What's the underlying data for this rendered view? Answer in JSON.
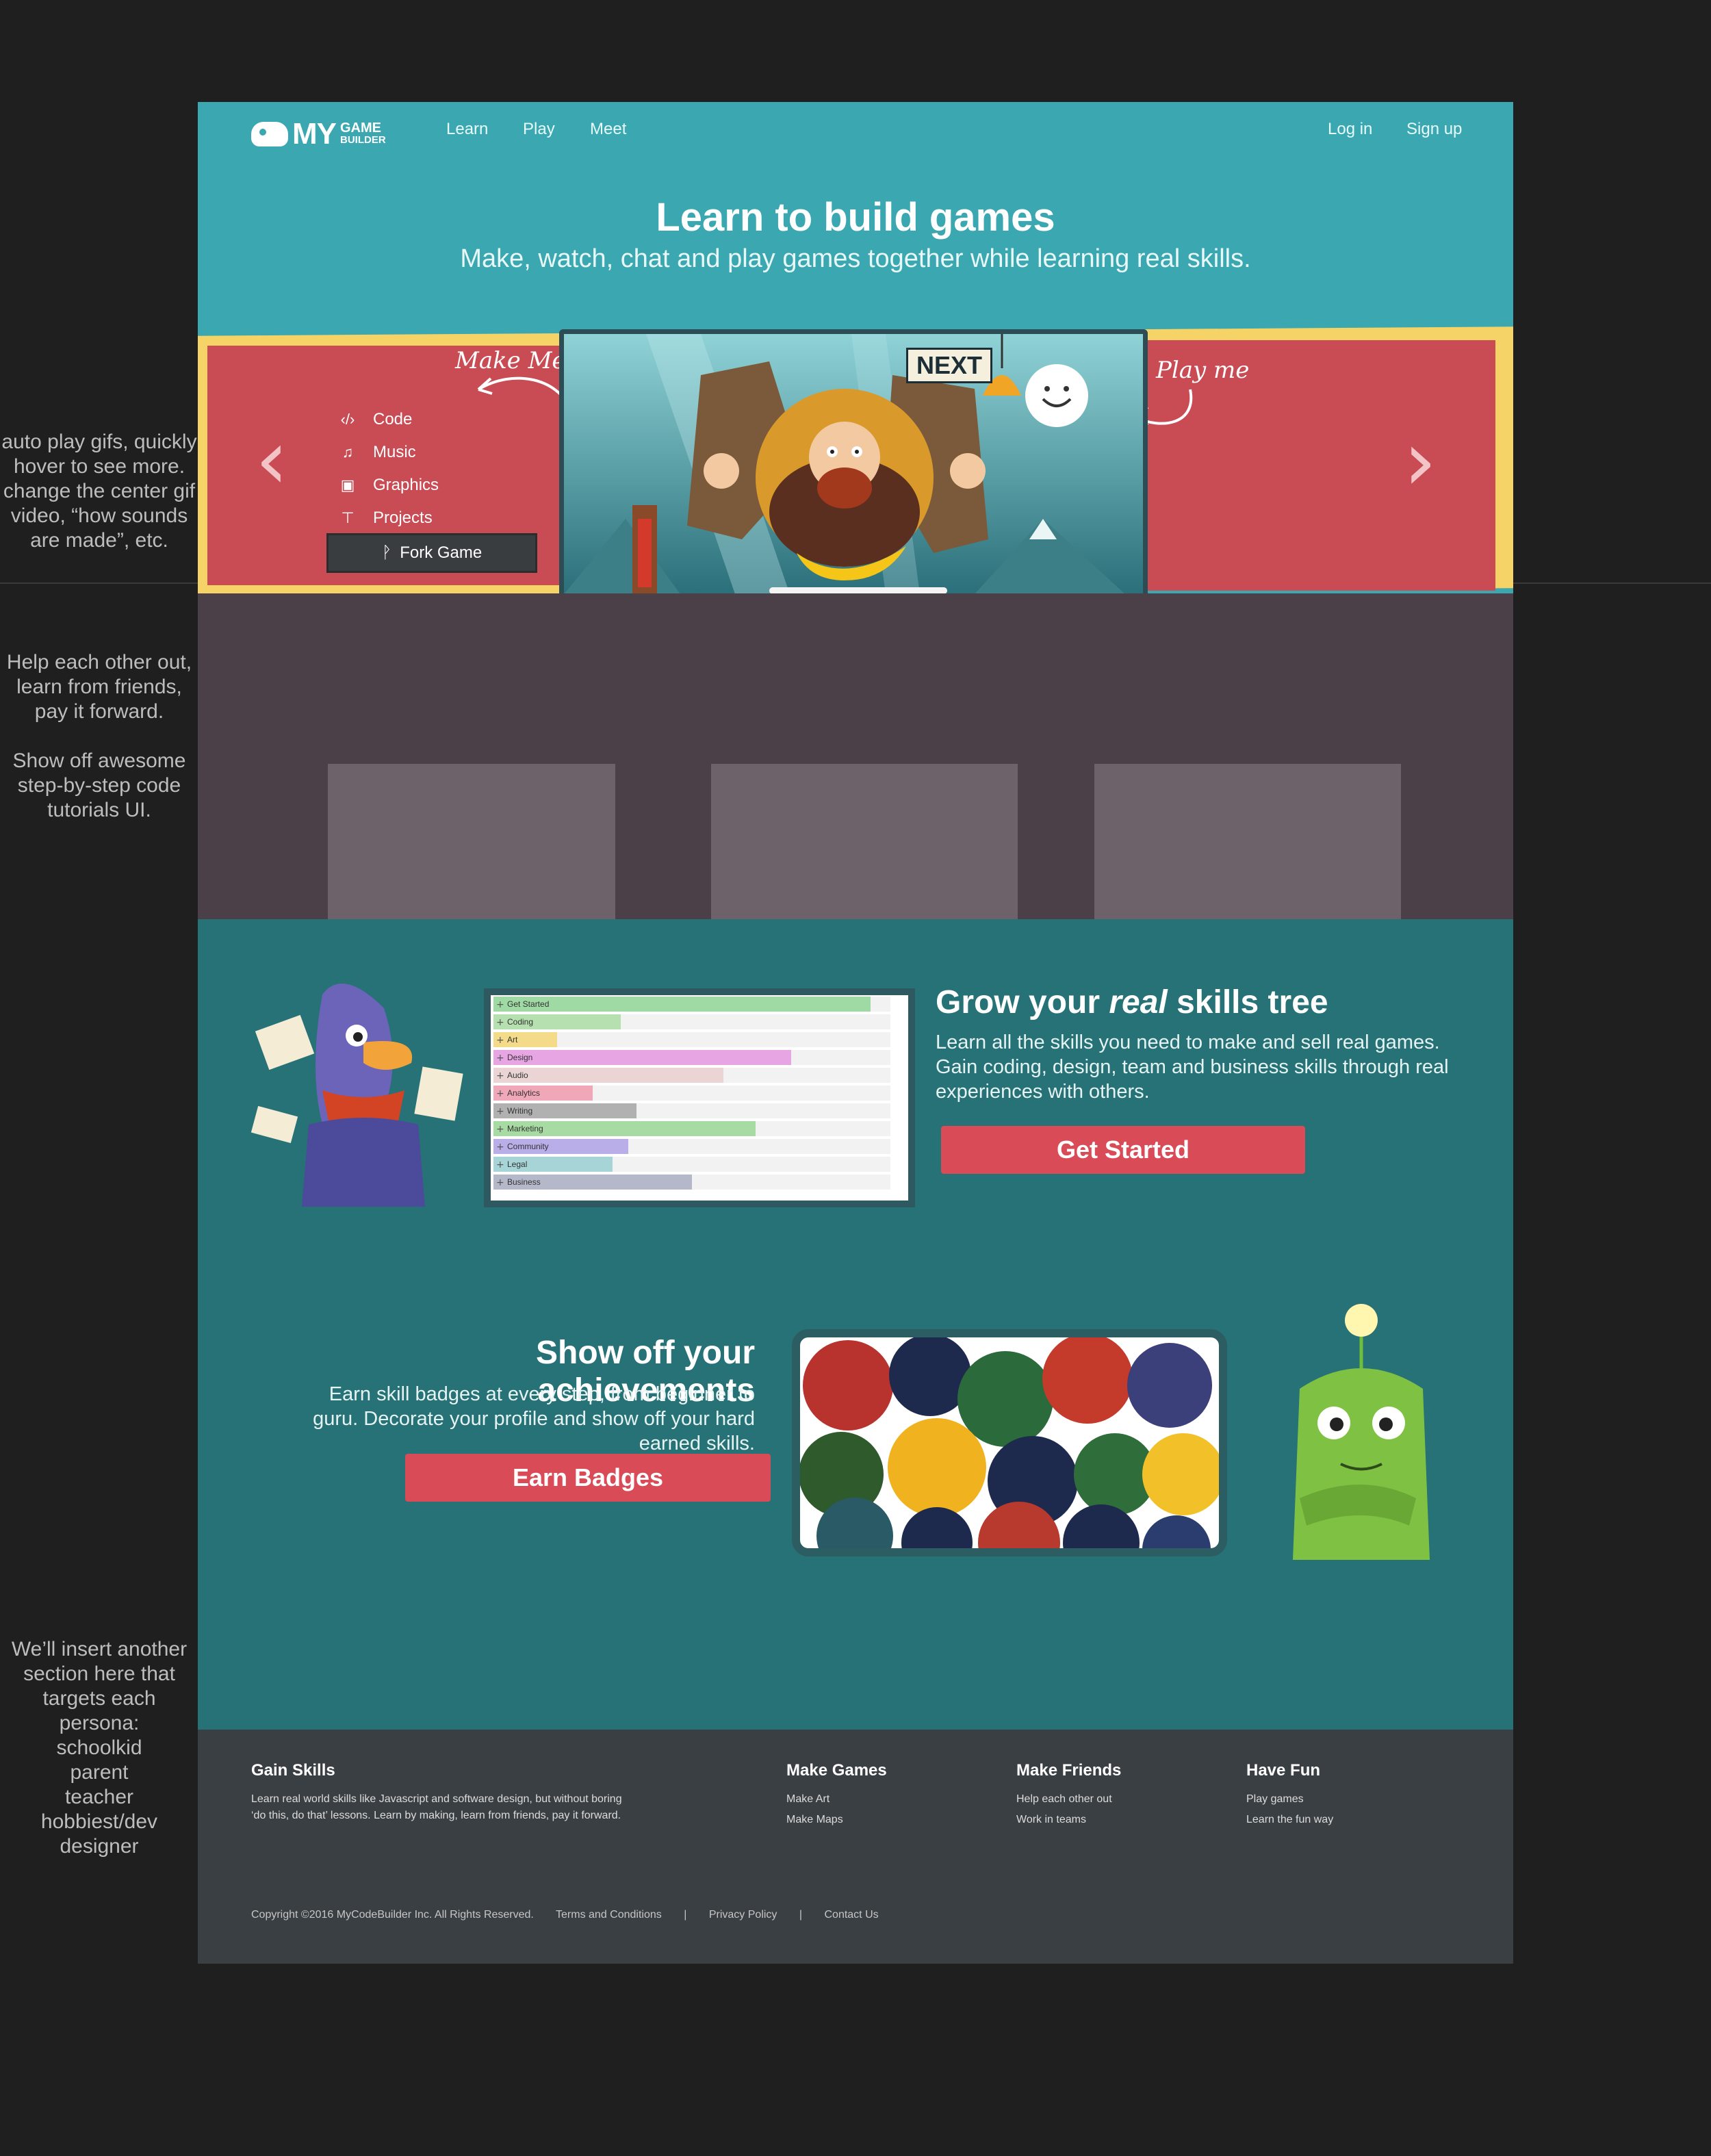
{
  "annotations": {
    "autoplay": "auto play gifs, quickly hover to see more. change the center gif video, “how sounds are made”, etc.",
    "help": "Help each other out, learn from friends, pay it forward.",
    "tutorials": "Show off awesome step-by-step code tutorials UI.",
    "persona": [
      "We’ll insert another section here that targets each persona:",
      "schoolkid",
      "parent",
      "teacher",
      "hobbiest/dev",
      "designer"
    ]
  },
  "nav": {
    "logo_my": "MY",
    "logo_game": "GAME",
    "logo_builder": "BUILDER",
    "links": [
      "Learn",
      "Play",
      "Meet"
    ],
    "login": "Log in",
    "signup": "Sign up"
  },
  "hero": {
    "title": "Learn to build games",
    "subtitle": "Make, watch, chat and play games together while learning real skills.",
    "make_me": "Make Me",
    "play_me": "Play me",
    "next": "NEXT",
    "menu": [
      {
        "icon": "code-icon",
        "glyph": "‹/›",
        "label": "Code"
      },
      {
        "icon": "music-icon",
        "glyph": "♫",
        "label": "Music"
      },
      {
        "icon": "image-icon",
        "glyph": "▣",
        "label": "Graphics"
      },
      {
        "icon": "sitemap-icon",
        "glyph": "⊤",
        "label": "Projects"
      }
    ],
    "fork_button": "Fork Game"
  },
  "skills": {
    "title_before": "Grow your ",
    "title_em": "real",
    "title_after": " skills tree",
    "text": "Learn all the skills you need to make and sell real games. Gain coding, design, team and business skills through real experiences with others.",
    "cta": "Get Started",
    "rows": [
      {
        "label": "Get Started",
        "value": 0.95,
        "color": "#9fd9a3"
      },
      {
        "label": "Coding",
        "value": 0.32,
        "color": "#b7e0b0"
      },
      {
        "label": "Art",
        "value": 0.16,
        "color": "#f4db8a"
      },
      {
        "label": "Design",
        "value": 0.75,
        "color": "#e7a6e3"
      },
      {
        "label": "Audio",
        "value": 0.58,
        "color": "#ead4d4"
      },
      {
        "label": "Analytics",
        "value": 0.25,
        "color": "#f0a7b7"
      },
      {
        "label": "Writing",
        "value": 0.36,
        "color": "#b1b1b1"
      },
      {
        "label": "Marketing",
        "value": 0.66,
        "color": "#a7dba3"
      },
      {
        "label": "Community",
        "value": 0.34,
        "color": "#b9aee8"
      },
      {
        "label": "Legal",
        "value": 0.3,
        "color": "#a7d4d6"
      },
      {
        "label": "Business",
        "value": 0.5,
        "color": "#b4b8c9"
      }
    ]
  },
  "achievements": {
    "title": "Show off your achievements",
    "text": "Earn skill badges at every step, from beginner to guru. Decorate your profile and show off your hard earned skills.",
    "cta": "Earn Badges"
  },
  "footer": {
    "columns": [
      {
        "title": "Gain Skills",
        "items": [
          "Learn real world skills like Javascript and software design, but without boring ‘do this, do that’ lessons. Learn by making, learn from friends, pay it forward."
        ]
      },
      {
        "title": "Make Games",
        "items": [
          "Make Art",
          "Make Maps"
        ]
      },
      {
        "title": "Make Friends",
        "items": [
          "Help each other out",
          "Work in teams"
        ]
      },
      {
        "title": "Have Fun",
        "items": [
          "Play games",
          "Learn the fun way"
        ]
      }
    ],
    "copyright": "Copyright ©2016 MyCodeBuilder Inc. All Rights Reserved.",
    "links": [
      "Terms and Conditions",
      "|",
      "Privacy Policy",
      "|",
      "Contact Us"
    ]
  }
}
